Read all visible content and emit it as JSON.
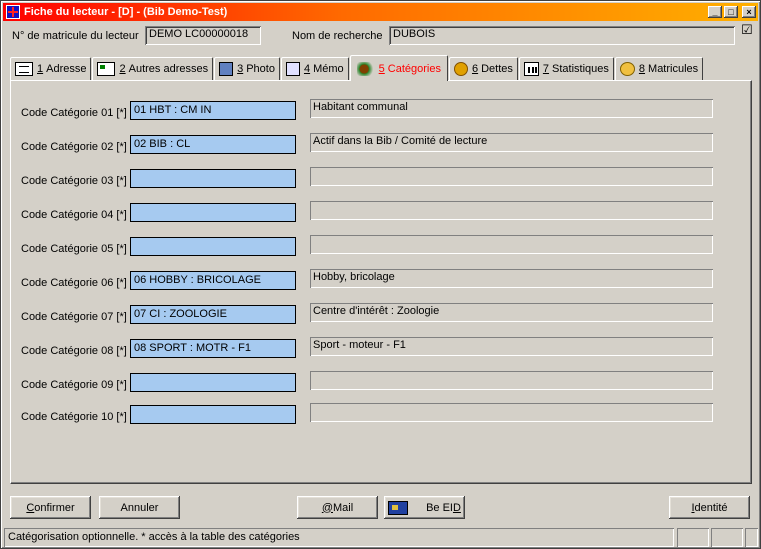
{
  "window": {
    "title": "Fiche du lecteur - [D] - (Bib Demo-Test)",
    "controls": {
      "minimize": "_",
      "maximize": "□",
      "close": "×"
    }
  },
  "header": {
    "matricule_label": "N° de matricule du lecteur",
    "matricule_value": "DEMO LC00000018",
    "recherche_label": "Nom de recherche",
    "recherche_value": "DUBOIS",
    "check_glyph": "☑"
  },
  "tabs": [
    {
      "num": "1",
      "label": "Adresse",
      "icon": "address-card-icon",
      "active": false
    },
    {
      "num": "2",
      "label": "Autres adresses",
      "icon": "other-addresses-icon",
      "active": false
    },
    {
      "num": "3",
      "label": "Photo",
      "icon": "photo-icon",
      "active": false
    },
    {
      "num": "4",
      "label": "Mémo",
      "icon": "memo-icon",
      "active": false
    },
    {
      "num": "5",
      "label": "Catégories",
      "icon": "categories-icon",
      "active": true
    },
    {
      "num": "6",
      "label": "Dettes",
      "icon": "coin-icon",
      "active": false
    },
    {
      "num": "7",
      "label": "Statistiques",
      "icon": "statistics-icon",
      "active": false
    },
    {
      "num": "8",
      "label": "Matricules",
      "icon": "matricules-icon",
      "active": false
    }
  ],
  "categories": [
    {
      "label": "Code Catégorie 01 [*]",
      "code": "01 HBT : CM IN",
      "description": "Habitant communal"
    },
    {
      "label": "Code Catégorie 02 [*]",
      "code": "02 BIB : CL",
      "description": "Actif dans la Bib / Comité de lecture"
    },
    {
      "label": "Code Catégorie 03 [*]",
      "code": "",
      "description": ""
    },
    {
      "label": "Code Catégorie 04 [*]",
      "code": "",
      "description": ""
    },
    {
      "label": "Code Catégorie 05 [*]",
      "code": "",
      "description": ""
    },
    {
      "label": "Code Catégorie 06 [*]",
      "code": "06 HOBBY : BRICOLAGE",
      "description": "Hobby, bricolage"
    },
    {
      "label": "Code Catégorie 07 [*]",
      "code": "07 CI : ZOOLOGIE",
      "description": "Centre d'intérêt : Zoologie"
    },
    {
      "label": "Code Catégorie 08 [*]",
      "code": "08 SPORT : MOTR - F1",
      "description": "Sport - moteur - F1"
    },
    {
      "label": "Code Catégorie 09 [*]",
      "code": "",
      "description": ""
    },
    {
      "label": "Code Catégorie 10 [*]",
      "code": "",
      "description": ""
    }
  ],
  "buttons": {
    "confirmer": {
      "ul": "C",
      "rest": "onfirmer"
    },
    "annuler": {
      "ul": "",
      "rest": "Annuler"
    },
    "mail": {
      "ul": "@",
      "rest": " Mail"
    },
    "beeid": {
      "pre": "Be EI",
      "ul": "D"
    },
    "identite": {
      "ul": "I",
      "rest": "dentité"
    }
  },
  "status": {
    "text": "Catégorisation optionnelle. * accès à la table des catégories"
  }
}
